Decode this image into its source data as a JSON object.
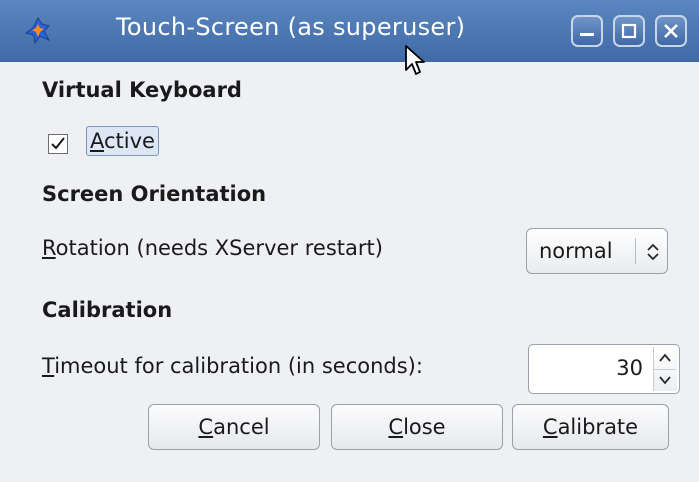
{
  "window": {
    "title": "Touch-Screen (as superuser)",
    "icons": {
      "app": "touch-screen-app-icon",
      "minimize": "minimize-icon",
      "maximize": "maximize-icon",
      "close": "close-icon"
    }
  },
  "virtual_keyboard": {
    "heading": "Virtual Keyboard",
    "active": {
      "mnemonic": "A",
      "rest": "ctive",
      "checked": true
    }
  },
  "screen_orientation": {
    "heading": "Screen Orientation",
    "rotation_label": {
      "mnemonic": "R",
      "rest": "otation (needs XServer restart)"
    },
    "rotation_value": "normal"
  },
  "calibration": {
    "heading": "Calibration",
    "timeout_label": {
      "mnemonic": "T",
      "rest": "imeout for calibration (in seconds):"
    },
    "timeout_value": "30"
  },
  "buttons": {
    "cancel": {
      "mnemonic": "C",
      "rest": "ancel"
    },
    "close": {
      "mnemonic": "C",
      "rest": "lose"
    },
    "calibrate": {
      "mnemonic": "C",
      "rest": "alibrate"
    }
  },
  "colors": {
    "titlebar": "#4a76b3",
    "background": "#eef0f3",
    "selection": "#dde6f5"
  }
}
